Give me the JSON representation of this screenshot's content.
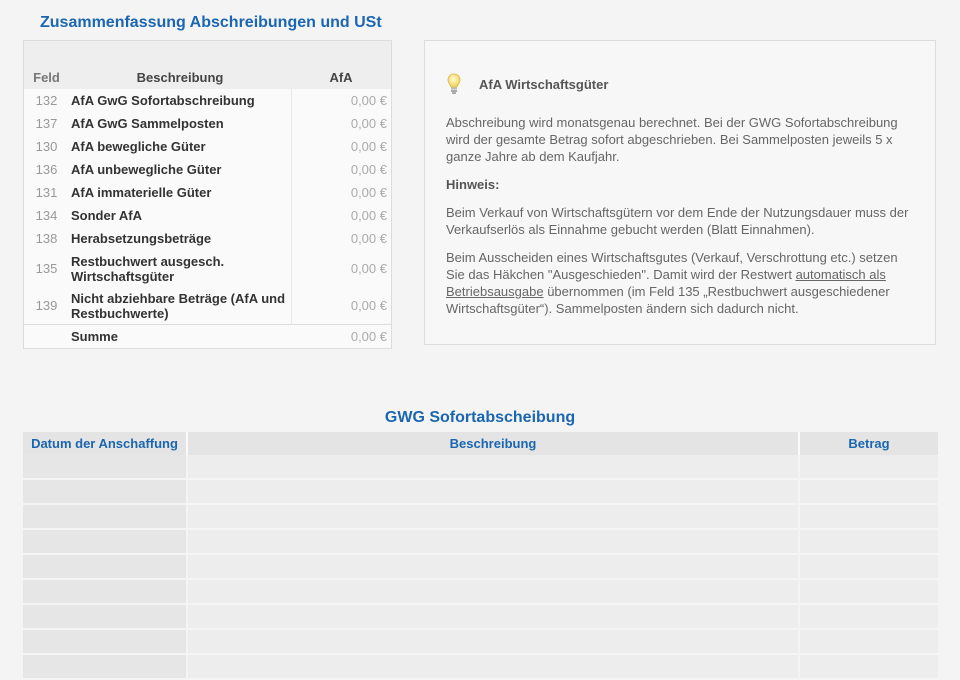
{
  "summary": {
    "title": "Zusammenfassung Abschreibungen und USt",
    "headers": {
      "feld": "Feld",
      "beschreibung": "Beschreibung",
      "afa": "AfA"
    },
    "rows": [
      {
        "feld": "132",
        "label": "AfA GwG Sofortabschreibung",
        "value": "0,00 €"
      },
      {
        "feld": "137",
        "label": "AfA GwG Sammelposten",
        "value": "0,00 €"
      },
      {
        "feld": "130",
        "label": "AfA bewegliche Güter",
        "value": "0,00 €"
      },
      {
        "feld": "136",
        "label": "AfA unbewegliche Güter",
        "value": "0,00 €"
      },
      {
        "feld": "131",
        "label": "AfA immaterielle Güter",
        "value": "0,00 €"
      },
      {
        "feld": "134",
        "label": "Sonder AfA",
        "value": "0,00 €"
      },
      {
        "feld": "138",
        "label": "Herabsetzungsbeträge",
        "value": "0,00 €"
      },
      {
        "feld": "135",
        "label": "Restbuchwert ausgesch. Wirtschaftsgüter",
        "value": "0,00 €"
      },
      {
        "feld": "139",
        "label": "Nicht abziehbare Beträge (AfA und Restbuchwerte)",
        "value": "0,00 €"
      }
    ],
    "sum": {
      "label": "Summe",
      "value": "0,00 €"
    }
  },
  "info": {
    "icon": "lightbulb-icon",
    "heading": "AfA Wirtschaftsgüter",
    "p1": "Abschreibung wird monatsgenau berechnet. Bei der GWG Sofortabschreibung wird der gesamte Betrag sofort abgeschrieben. Bei Sammelposten jeweils 5 x ganze Jahre ab dem Kaufjahr.",
    "hint_label": "Hinweis:",
    "p2": "Beim Verkauf von Wirtschaftsgütern vor dem Ende der Nutzungsdauer muss der Verkaufserlös als Einnahme gebucht werden (Blatt Einnahmen).",
    "p3_a": "Beim Ausscheiden eines Wirtschaftsgutes (Verkauf, Verschrottung etc.) setzen Sie das Häkchen \"Ausgeschieden\". Damit wird der Restwert ",
    "p3_link": "automatisch als Betriebsausgabe",
    "p3_b": " übernommen (im Feld 135 „Restbuchwert ausgeschiedener Wirtschaftsgüter“). Sammelposten ändern sich dadurch nicht."
  },
  "gwg": {
    "title": "GWG Sofortabscheibung",
    "headers": {
      "datum": "Datum der Anschaffung",
      "beschreibung": "Beschreibung",
      "betrag": "Betrag"
    },
    "empty_rows": 9
  },
  "colors": {
    "accent": "#1b66b1"
  }
}
